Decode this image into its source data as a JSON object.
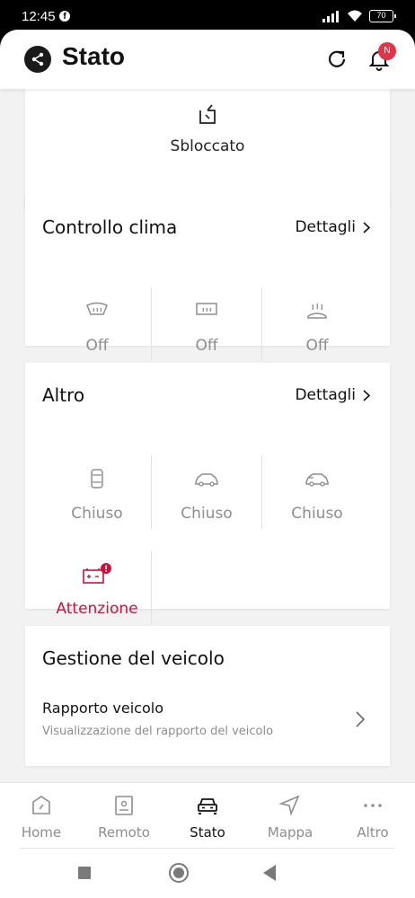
{
  "status_bar": {
    "time": "12:45",
    "battery": "70"
  },
  "header": {
    "title": "Stato",
    "notification_badge": "N"
  },
  "lock_card": {
    "status": "Sbloccato"
  },
  "clima_card": {
    "title": "Controllo clima",
    "details_label": "Dettagli",
    "items": [
      {
        "icon": "front-defrost-icon",
        "label": "Off"
      },
      {
        "icon": "rear-defrost-icon",
        "label": "Off"
      },
      {
        "icon": "seat-heater-icon",
        "label": "Off"
      }
    ]
  },
  "altro_card": {
    "title": "Altro",
    "details_label": "Dettagli",
    "items": [
      {
        "icon": "car-doors-icon",
        "label": "Chiuso"
      },
      {
        "icon": "car-trunk-icon",
        "label": "Chiuso"
      },
      {
        "icon": "car-hood-icon",
        "label": "Chiuso"
      },
      {
        "icon": "battery-warning-icon",
        "label": "Attenzione"
      }
    ]
  },
  "gestione_card": {
    "title": "Gestione del veicolo",
    "report_title": "Rapporto veicolo",
    "report_subtitle": "Visualizzazione del rapporto del veicolo"
  },
  "bottom_nav": {
    "items": [
      {
        "icon": "home-icon",
        "label": "Home"
      },
      {
        "icon": "remote-icon",
        "label": "Remoto"
      },
      {
        "icon": "car-icon",
        "label": "Stato",
        "active": true
      },
      {
        "icon": "navigation-icon",
        "label": "Mappa"
      },
      {
        "icon": "more-icon",
        "label": "Altro"
      }
    ]
  },
  "colors": {
    "accent_alert": "#d0103a",
    "badge": "#e0344b",
    "inactive_text": "#8d8d8d"
  }
}
